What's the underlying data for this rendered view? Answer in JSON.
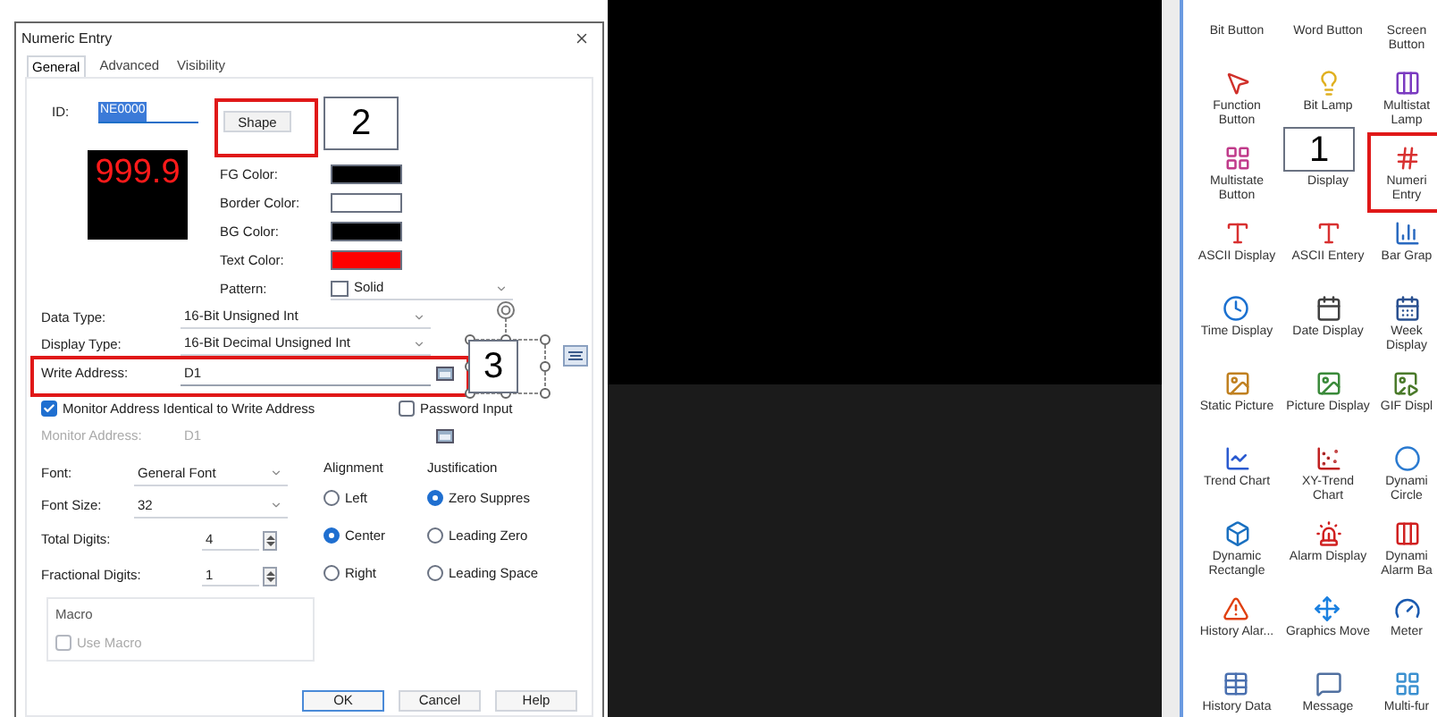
{
  "dialog": {
    "title": "Numeric Entry",
    "tabs": [
      {
        "label": "General",
        "selected": true
      },
      {
        "label": "Advanced",
        "selected": false
      },
      {
        "label": "Visibility",
        "selected": false
      }
    ],
    "id": {
      "label": "ID:",
      "value": "NE0000"
    },
    "preview": {
      "text": "999.9"
    },
    "shape_button": "Shape",
    "colors": [
      {
        "label": "FG Color:",
        "color": "#000000"
      },
      {
        "label": "Border Color:",
        "color": "#ffffff"
      },
      {
        "label": "BG Color:",
        "color": "#000000"
      },
      {
        "label": "Text Color:",
        "color": "#ff0000"
      }
    ],
    "pattern": {
      "label": "Pattern:",
      "value": "Solid"
    },
    "data_type": {
      "label": "Data Type:",
      "value": "16-Bit Unsigned Int"
    },
    "display_type": {
      "label": "Display Type:",
      "value": "16-Bit Decimal Unsigned Int"
    },
    "write_address": {
      "label": "Write Address:",
      "value": "D1"
    },
    "monitor_identical": {
      "label": "Monitor Address Identical to Write Address",
      "checked": true
    },
    "password_input": {
      "label": "Password Input",
      "checked": false
    },
    "monitor_address": {
      "label": "Monitor Address:",
      "value": "D1",
      "disabled": true
    },
    "font": {
      "label": "Font:",
      "value": "General Font"
    },
    "font_size": {
      "label": "Font Size:",
      "value": "32"
    },
    "total_digits": {
      "label": "Total Digits:",
      "value": "4"
    },
    "fractional_digits": {
      "label": "Fractional Digits:",
      "value": "1"
    },
    "alignment": {
      "title": "Alignment",
      "options": [
        {
          "label": "Left",
          "selected": false
        },
        {
          "label": "Center",
          "selected": true
        },
        {
          "label": "Right",
          "selected": false
        }
      ]
    },
    "justification": {
      "title": "Justification",
      "options": [
        {
          "label": "Zero Suppres",
          "selected": true
        },
        {
          "label": "Leading Zero",
          "selected": false
        },
        {
          "label": "Leading Space",
          "selected": false
        }
      ]
    },
    "macro": {
      "title": "Macro",
      "use_macro": {
        "label": "Use Macro",
        "checked": false,
        "disabled": true
      }
    },
    "buttons": [
      "OK",
      "Cancel",
      "Help"
    ]
  },
  "callouts": [
    {
      "label": "2"
    },
    {
      "label": "3"
    },
    {
      "label": "1"
    }
  ],
  "palette": {
    "items": [
      {
        "label": "Bit Button"
      },
      {
        "label": "Word Button"
      },
      {
        "label": "Screen Button"
      },
      {
        "label": "Function Button"
      },
      {
        "label": "Bit Lamp"
      },
      {
        "label": "Multistat Lamp"
      },
      {
        "label": "Multistate Button"
      },
      {
        "label": "Display"
      },
      {
        "label": "Numeri Entry"
      },
      {
        "label": "ASCII Display"
      },
      {
        "label": "ASCII Entery"
      },
      {
        "label": "Bar Grap"
      },
      {
        "label": "Time Display"
      },
      {
        "label": "Date Display"
      },
      {
        "label": "Week Display"
      },
      {
        "label": "Static Picture"
      },
      {
        "label": "Picture Display"
      },
      {
        "label": "GIF Displ"
      },
      {
        "label": "Trend Chart"
      },
      {
        "label": "XY-Trend Chart"
      },
      {
        "label": "Dynami Circle"
      },
      {
        "label": "Dynamic Rectangle"
      },
      {
        "label": "Alarm Display"
      },
      {
        "label": "Dynami Alarm Ba"
      },
      {
        "label": "History Alar..."
      },
      {
        "label": "Graphics Move"
      },
      {
        "label": "Meter"
      },
      {
        "label": "History Data"
      },
      {
        "label": "Message"
      },
      {
        "label": "Multi-fur"
      }
    ]
  }
}
